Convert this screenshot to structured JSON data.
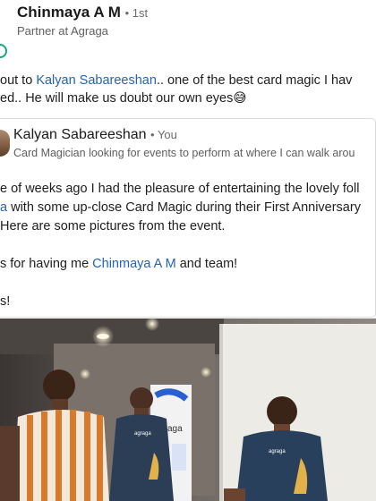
{
  "post": {
    "author_name": "Chinmaya A M",
    "author_degree": "• 1st",
    "author_headline": "Partner at Agraga",
    "text_line1_prefix": "out to ",
    "text_line1_mention": "Kalyan Sabareeshan",
    "text_line1_suffix": ".. one of the best card magic I hav",
    "text_line2": "ed.. He will make us doubt our own eyes",
    "emoji": "😅"
  },
  "shared_post": {
    "author_name": "Kalyan Sabareeshan",
    "author_degree": "• You",
    "author_headline": "Card Magician looking for events to perform at where I can walk arou",
    "line1": "e of weeks ago I had the pleasure of entertaining the lovely foll",
    "line2_mention": "a",
    "line2_rest": " with some up-close Card Magic during their First Anniversary",
    "line3": "Here are some pictures from the event.",
    "line4_prefix": "s for having me ",
    "line4_mention": "Chinmaya A M",
    "line4_suffix": " and team!",
    "line5": "s!"
  },
  "photo": {
    "banner_text": "aga",
    "shirt_logo_text": "agraga"
  },
  "colors": {
    "link": "#2263b5",
    "brand_ring": "#13a87a",
    "banner_blue": "#2a5fcf"
  }
}
